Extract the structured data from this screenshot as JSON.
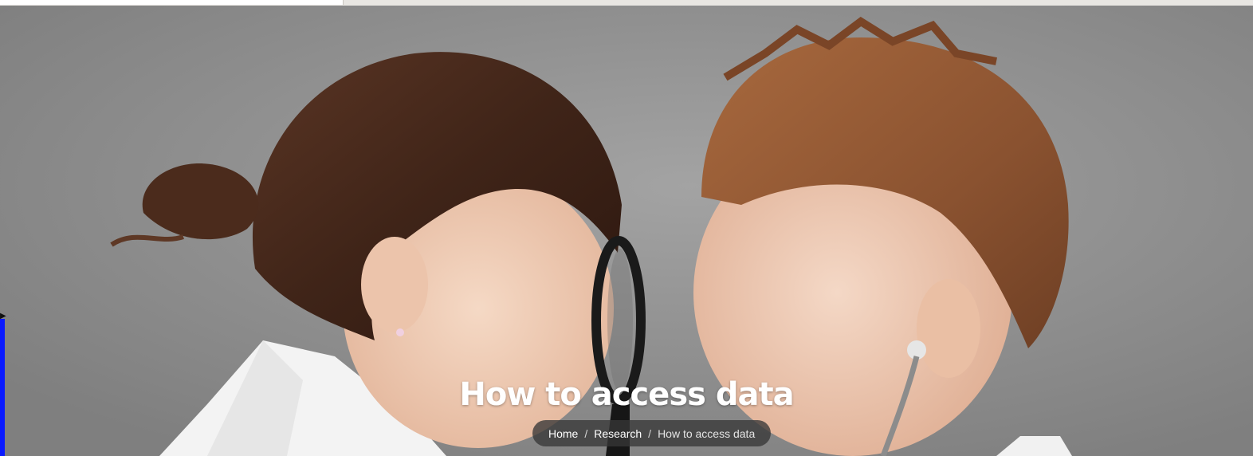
{
  "hero": {
    "title": "How to access data",
    "image_alt": "Girl with magnifying glass and boy with stethoscope"
  },
  "breadcrumb": {
    "items": [
      {
        "label": "Home"
      },
      {
        "label": "Research"
      }
    ],
    "separator": "/",
    "current": "How to access data"
  },
  "colors": {
    "overlay": "#373737",
    "title": "#ffffff",
    "background": "#8b8b8b"
  }
}
